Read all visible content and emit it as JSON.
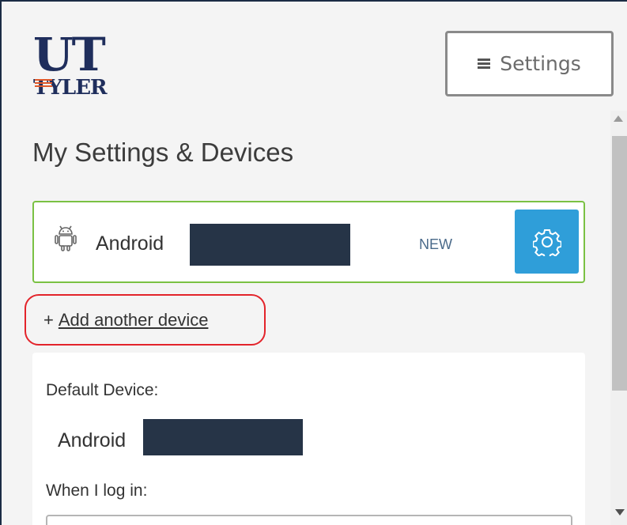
{
  "header": {
    "logo": {
      "line1": "UT",
      "line2": "TYLER"
    },
    "settings_button": {
      "label": "Settings",
      "icon": "hamburger-menu-icon"
    }
  },
  "page": {
    "title": "My Settings & Devices"
  },
  "device_card": {
    "device_type": "Android",
    "icon": "android-icon",
    "status": "NEW",
    "settings_icon": "gear-icon",
    "colors": {
      "border": "#7ac143",
      "gear_button": "#2f9ed9"
    }
  },
  "add_device": {
    "plus": "+",
    "label": "Add another device"
  },
  "preferences": {
    "default_device_label": "Default Device:",
    "default_device_value": "Android",
    "login_label": "When I log in:"
  },
  "colors": {
    "brand_navy": "#1f2e5c",
    "brand_orange": "#e0592a",
    "highlight_red": "#e3242b"
  }
}
